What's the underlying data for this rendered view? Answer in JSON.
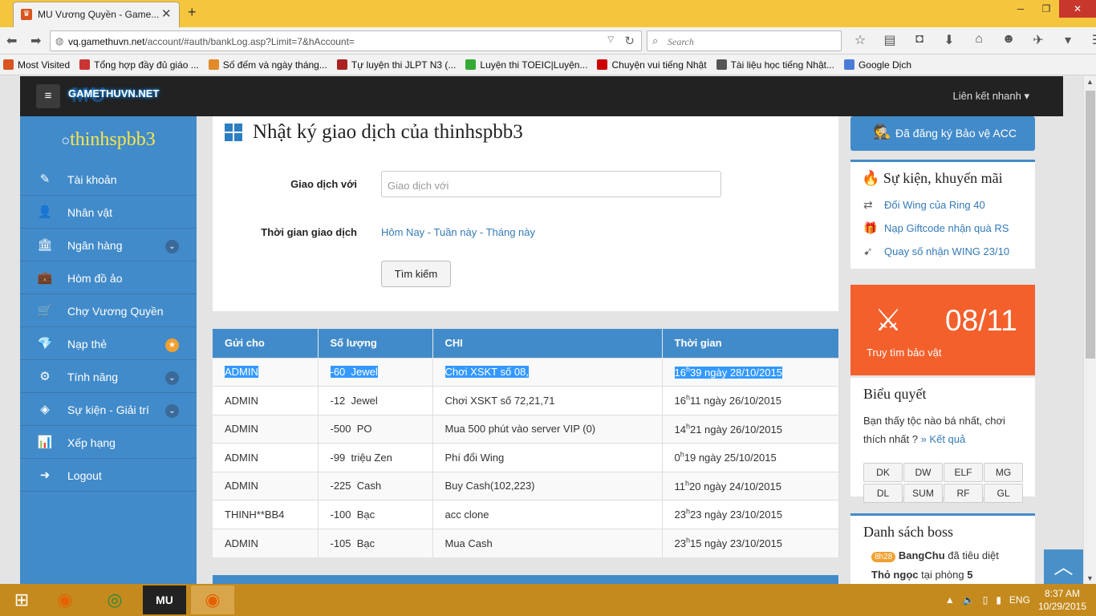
{
  "browser": {
    "tab_title": "MU Vương Quyền - Game...",
    "url_host": "vq.gamethuvn.net",
    "url_path": "/account/#auth/bankLog.asp?Limit=7&hAccount=",
    "search_placeholder": "Search",
    "bookmarks": [
      {
        "label": "Most Visited",
        "color": "#d9541e"
      },
      {
        "label": "Tổng hợp đầy đủ giáo ...",
        "color": "#c33"
      },
      {
        "label": "Số đếm và ngày tháng...",
        "color": "#e08a2a"
      },
      {
        "label": "Tự luyện thi JLPT N3 (...",
        "color": "#a22"
      },
      {
        "label": "Luyện thi TOEIC|Luyện...",
        "color": "#3a3"
      },
      {
        "label": "Chuyện vui tiếng Nhật",
        "color": "#c00"
      },
      {
        "label": "Tài liệu học tiếng Nhật...",
        "color": "#555"
      },
      {
        "label": "Google Dịch",
        "color": "#4a7bd9"
      }
    ]
  },
  "header": {
    "logo": "GAMETHUVN.NET",
    "logo_bg": "MU",
    "quick_links": "Liên kết nhanh"
  },
  "sidebar": {
    "username": "thinhspbb3",
    "items": [
      {
        "label": "Tài khoản",
        "icon": "✎"
      },
      {
        "label": "Nhân vật",
        "icon": "👤"
      },
      {
        "label": "Ngân hàng",
        "icon": "🏛"
      },
      {
        "label": "Hòm đồ ảo",
        "icon": "💼"
      },
      {
        "label": "Chợ Vương Quyền",
        "icon": "🛒"
      },
      {
        "label": "Nạp thẻ",
        "icon": "💎"
      },
      {
        "label": "Tính năng",
        "icon": "⚙"
      },
      {
        "label": "Sự kiện - Giải trí",
        "icon": "◈"
      },
      {
        "label": "Xếp hạng",
        "icon": "📊"
      },
      {
        "label": "Logout",
        "icon": "➜"
      }
    ]
  },
  "main": {
    "title": "Nhật ký giao dịch của thinhspbb3",
    "field_partner_label": "Giao dịch với",
    "field_partner_placeholder": "Giao dịch với",
    "field_time_label": "Thời gian giao dịch",
    "time_today": "Hôm Nay",
    "time_week": "Tuần này",
    "time_month": "Tháng này",
    "sep": " - ",
    "search_button": "Tìm kiếm"
  },
  "table": {
    "headers": [
      "Gửi cho",
      "Số lượng",
      "CHI",
      "Thời gian"
    ],
    "rows": [
      {
        "to": "ADMIN",
        "amount": "-60",
        "unit": "Jewel",
        "desc": "Chơi XSKT số 08,",
        "hour": "16",
        "rest": "39 ngày 28/10/2015"
      },
      {
        "to": "ADMIN",
        "amount": "-12",
        "unit": "Jewel",
        "desc": "Chơi XSKT số 72,21,71",
        "hour": "16",
        "rest": "11 ngày 26/10/2015"
      },
      {
        "to": "ADMIN",
        "amount": "-500",
        "unit": "PO",
        "desc": "Mua 500 phút vào server VIP (0)",
        "hour": "14",
        "rest": "21 ngày 26/10/2015"
      },
      {
        "to": "ADMIN",
        "amount": "-99",
        "unit": "triệu Zen",
        "desc": "Phí đổi Wing",
        "hour": "0",
        "rest": "19 ngày 25/10/2015"
      },
      {
        "to": "ADMIN",
        "amount": "-225",
        "unit": "Cash",
        "desc": "Buy Cash(102,223)",
        "hour": "11",
        "rest": "20 ngày 24/10/2015"
      },
      {
        "to": "THINH**BB4",
        "amount": "-100",
        "unit": "Bạc",
        "desc": "acc clone",
        "hour": "23",
        "rest": "23 ngày 23/10/2015"
      },
      {
        "to": "ADMIN",
        "amount": "-105",
        "unit": "Bạc",
        "desc": "Mua Cash",
        "hour": "23",
        "rest": "15 ngày 23/10/2015"
      }
    ],
    "hour_sup": "h"
  },
  "right": {
    "protect_label": "Đã đăng ký Bảo vệ ACC",
    "events_title": "Sự kiện, khuyến mãi",
    "events": [
      "Đổi Wing của Ring 40",
      "Nạp Giftcode nhận quà RS",
      "Quay số nhận WING 23/10"
    ],
    "hunt_date": "08/11",
    "hunt_label": "Truy tìm bảo vật",
    "poll_title": "Biểu quyết",
    "poll_question": "Bạn thấy tộc nào bá nhất, chơi thích nhất ?",
    "poll_result": "» Kết quả",
    "poll_options": [
      "DK",
      "DW",
      "ELF",
      "MG",
      "DL",
      "SUM",
      "RF",
      "GL"
    ],
    "boss_title": "Danh sách boss",
    "boss_time": "8h28",
    "boss_name": "BangChu",
    "boss_action": "đã tiêu diệt",
    "boss_target": "Thỏ ngọc",
    "boss_room_text": "tại phòng",
    "boss_room": "5"
  },
  "taskbar": {
    "lang": "ENG",
    "time": "8:37 AM",
    "date": "10/29/2015"
  },
  "colors": {
    "accent": "#428bca",
    "hunt": "#f4602c",
    "username": "#f9e64b",
    "highlight": "#3399ff"
  }
}
